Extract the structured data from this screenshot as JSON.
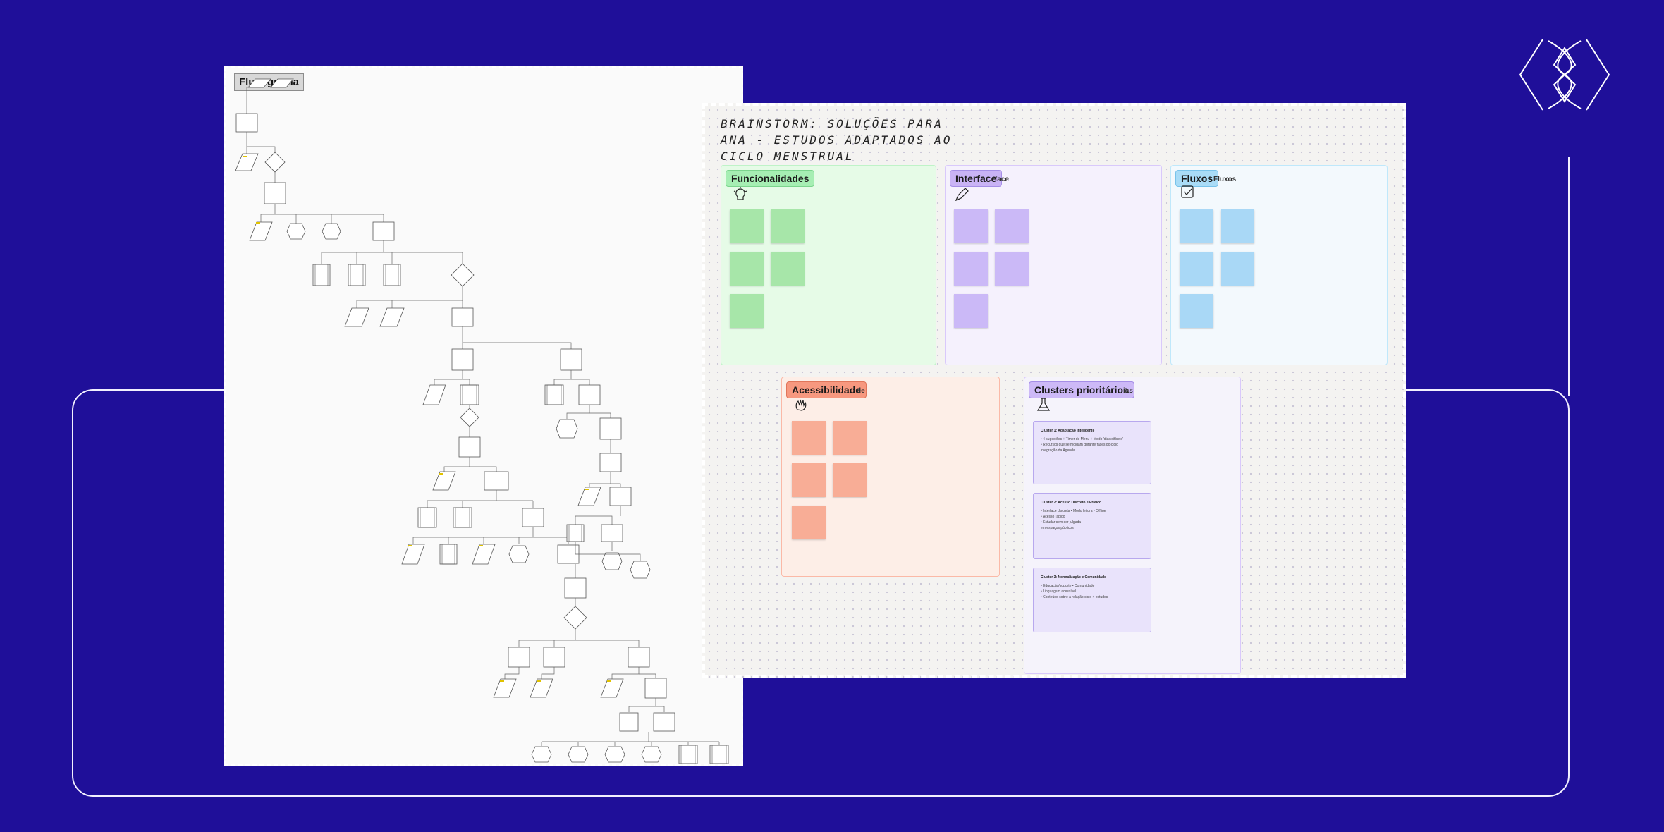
{
  "flowchart": {
    "tag": "Fluxograma"
  },
  "brainstorm": {
    "title": "BRAINSTORM: SOLUÇÕES PARA ANA - ESTUDOS ADAPTADOS AO CICLO MENSTRUAL",
    "sections": [
      {
        "label": "Funcionalidades",
        "sub": "s",
        "color": "#bff3c8",
        "labelColor": "#a6eeb3",
        "bg": "#e6fbe7",
        "stickyColor": "#a7e6a9",
        "notes": 5
      },
      {
        "label": "Interface",
        "sub": "rface",
        "color": "#d9c9fb",
        "labelColor": "#c9b3f5",
        "bg": "#f5f1fd",
        "stickyColor": "#cbb9f7",
        "notes": 5
      },
      {
        "label": "Fluxos",
        "sub": "Fluxos",
        "color": "#bfe8fb",
        "labelColor": "#a9dcf7",
        "bg": "#f3f9fd",
        "stickyColor": "#a9d8f6",
        "notes": 5
      },
      {
        "label": "Acessibilidade",
        "sub": "de",
        "color": "#fbb9a7",
        "labelColor": "#f7987f",
        "bg": "#fdeee7",
        "stickyColor": "#f8ad96",
        "notes": 5
      },
      {
        "label": "Clusters prioritários",
        "sub": "ias",
        "color": "#d9c9fb",
        "labelColor": "#cdb9f7",
        "bg": "#f5f3fb",
        "stickyColor": "#e9e3fb",
        "notes": 0
      }
    ],
    "clusters": [
      {
        "title": "Cluster 1: Adaptação Inteligente",
        "lines": [
          "• 4 sugestões + Timer de Menu + Modo 'dias difíceis'",
          "• Recursos que se moldam durante fases do ciclo",
          "  integração da Agenda"
        ]
      },
      {
        "title": "Cluster 2: Acesso Discreto e Prático",
        "lines": [
          "• Interface discreta • Modo leitura • Offline",
          "  • Acesso rápido",
          "• Estudar sem ser julgada",
          "  em espaços públicos"
        ]
      },
      {
        "title": "Cluster 3: Normalização e Comunidade",
        "lines": [
          "• Educação/suporte • Comunidade",
          "• Linguagem acessível",
          "• Conteúdo sobre a relação ciclo × estudos"
        ]
      }
    ]
  },
  "colors": {
    "background": "#1f0f99",
    "outline": "#f2f0ff"
  }
}
